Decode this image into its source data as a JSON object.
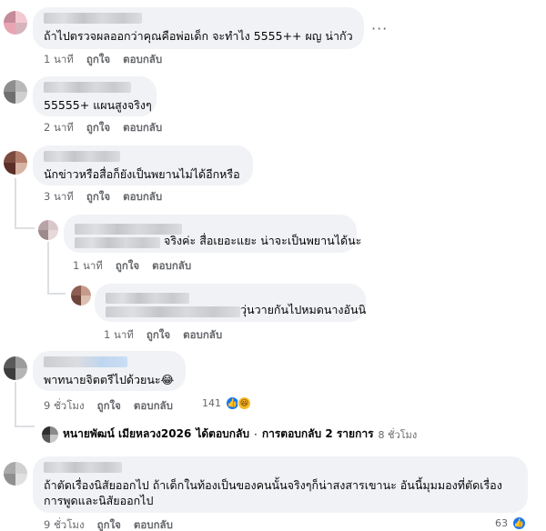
{
  "comments": [
    {
      "text": "ถ้าไปตรวจผลออกว่าคุณคือพ่อเด็ก จะทำไง 5555++ ผญ น่ากัว",
      "time": "1 นาที",
      "like": "ถูกใจ",
      "reply": "ตอบกลับ",
      "more": "···",
      "avatar_colors": [
        "#c58b9a",
        "#f2c9d1",
        "#e8a4b3",
        "#d7b3bc"
      ]
    },
    {
      "text": "55555+ แผนสูงจริงๆ",
      "time": "2 นาที",
      "like": "ถูกใจ",
      "reply": "ตอบกลับ",
      "avatar_colors": [
        "#8e8e8e",
        "#b9b9b9",
        "#6f6f6f",
        "#cfcfcf"
      ]
    },
    {
      "text": "นักข่าวหรือสื่อก็ยังเป็นพยานไม่ได้อีกหรือ",
      "time": "3 นาที",
      "like": "ถูกใจ",
      "reply": "ตอบกลับ",
      "avatar_colors": [
        "#7a4a3d",
        "#b37e6b",
        "#5b2f27",
        "#d8b3a3"
      ],
      "replies": [
        {
          "text": "จริงค่ะ สื่อเยอะแยะ น่าจะเป็นพยานได้นะ",
          "time": "1 นาที",
          "like": "ถูกใจ",
          "reply": "ตอบกลับ",
          "avatar_colors": [
            "#b8a3a6",
            "#d9c7c9",
            "#9d8a8c",
            "#e6d9da"
          ]
        },
        {
          "text": "วุ่นวายกันไปหมดนางอันนิ",
          "time": "1 นาที",
          "like": "ถูกใจ",
          "reply": "ตอบกลับ",
          "avatar_colors": [
            "#8c5d50",
            "#c49b8b",
            "#6e443a",
            "#ddbfb2"
          ]
        }
      ]
    },
    {
      "text": "พาทนายจิตตรีไปด้วยนะ😂",
      "time": "9 ชั่วโมง",
      "like": "ถูกใจ",
      "reply": "ตอบกลับ",
      "reaction_count": "141",
      "avatar_colors": [
        "#5a5a5a",
        "#9c9c9c",
        "#3d3d3d",
        "#b5b5b5"
      ],
      "reply_summary": {
        "author": "หนายพัฒน์ เมียหลวง2026",
        "action": "ได้ตอบกลับ",
        "sep": "·",
        "count_text": "การตอบกลับ 2 รายการ",
        "time": "8 ชั่วโมง"
      }
    },
    {
      "text": "ถ้าตัดเรื่องนิสัยออกไป ถ้าเด็กในท้องเป็นของคนนั้นจริงๆก็น่าสงสารเขานะ อันนี้มุมมองที่ตัดเรื่องการพูดและนิสัยออกไป",
      "time": "9 ชั่วโมง",
      "like": "ถูกใจ",
      "reply": "ตอบกลับ",
      "reaction_count": "63",
      "avatar_colors": [
        "#a9a9a9",
        "#d1d1d1",
        "#8f8f8f",
        "#e0e0e0"
      ]
    }
  ],
  "icons": {
    "like": "like-reaction-icon",
    "haha": "haha-reaction-icon",
    "reply_arrow": "reply-arrow-icon"
  },
  "colors": {
    "bubble": "#f0f2f5",
    "meta": "#65676b",
    "like_blue": "#1877f2"
  }
}
